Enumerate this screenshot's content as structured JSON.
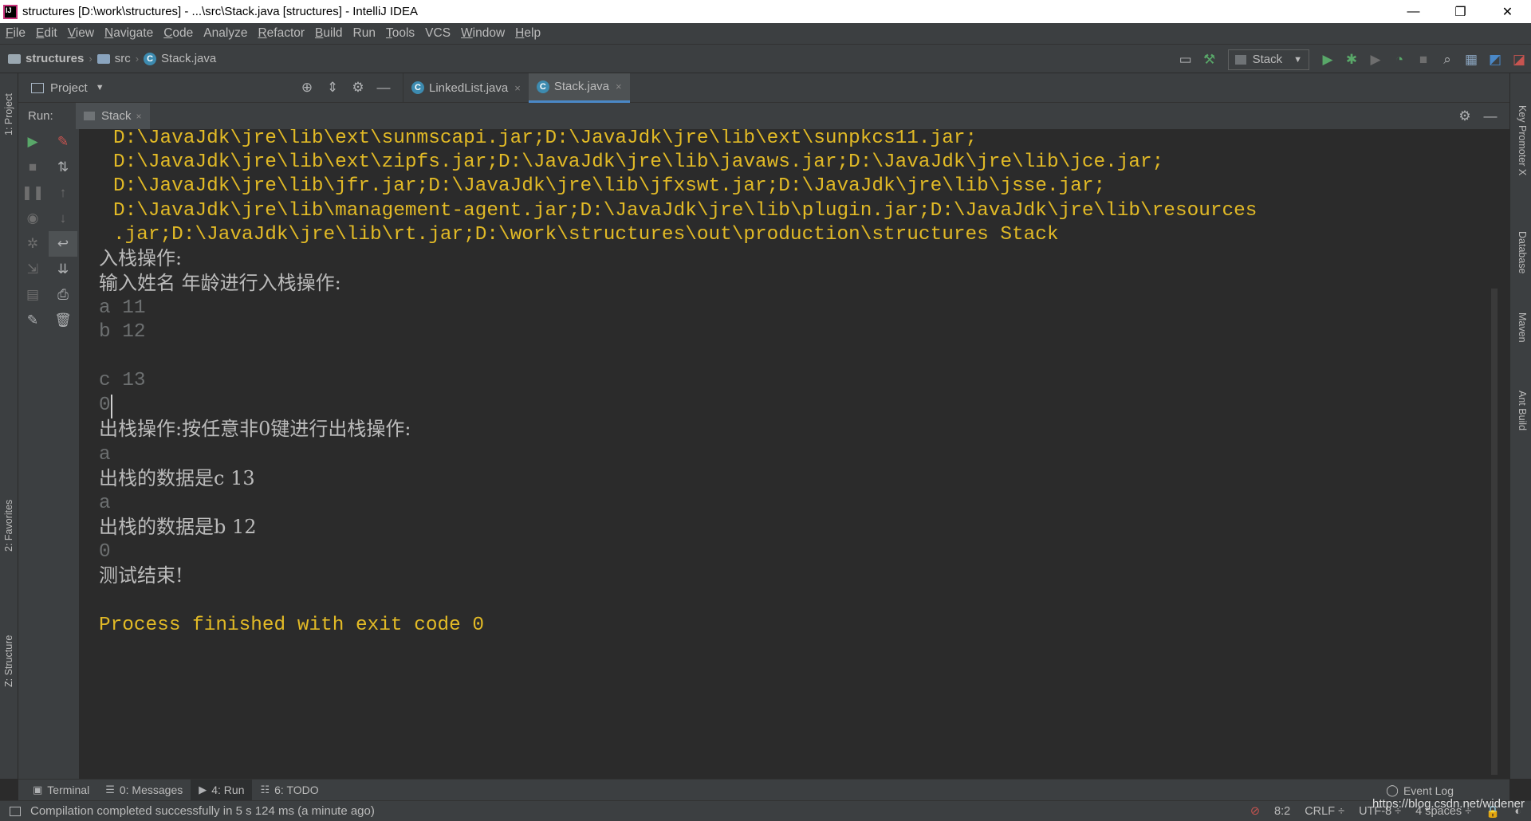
{
  "window": {
    "title": "structures [D:\\work\\structures] - ...\\src\\Stack.java [structures] - IntelliJ IDEA",
    "minimize": "—",
    "restore": "❐",
    "close": "✕"
  },
  "menu": {
    "items": [
      {
        "u": "F",
        "rest": "ile"
      },
      {
        "u": "E",
        "rest": "dit"
      },
      {
        "u": "V",
        "rest": "iew"
      },
      {
        "u": "N",
        "rest": "avigate"
      },
      {
        "u": "C",
        "rest": "ode"
      },
      {
        "u": "",
        "rest": "Analyze"
      },
      {
        "u": "R",
        "rest": "efactor"
      },
      {
        "u": "B",
        "rest": "uild"
      },
      {
        "u": "",
        "rest": "Run"
      },
      {
        "u": "T",
        "rest": "ools"
      },
      {
        "u": "",
        "rest": "VCS"
      },
      {
        "u": "W",
        "rest": "indow"
      },
      {
        "u": "H",
        "rest": "elp"
      }
    ]
  },
  "breadcrumb": {
    "project": "structures",
    "folder": "src",
    "file": "Stack.java"
  },
  "toolbar": {
    "run_config": "Stack"
  },
  "project_panel": {
    "label": "Project"
  },
  "editor_tabs": [
    {
      "label": "LinkedList.java",
      "active": false
    },
    {
      "label": "Stack.java",
      "active": true
    }
  ],
  "run_panel": {
    "label": "Run:",
    "tab": "Stack"
  },
  "left_stripe": {
    "project": "1: Project",
    "favorites": "2: Favorites",
    "structure": "Z: Structure"
  },
  "right_stripe": {
    "key_promoter": "Key Promoter X",
    "database": "Database",
    "maven": "Maven",
    "ant": "Ant Build"
  },
  "console": {
    "classpath_lines": [
      "D:\\JavaJdk\\jre\\lib\\ext\\sunmscapi.jar;D:\\JavaJdk\\jre\\lib\\ext\\sunpkcs11.jar;",
      "D:\\JavaJdk\\jre\\lib\\ext\\zipfs.jar;D:\\JavaJdk\\jre\\lib\\javaws.jar;D:\\JavaJdk\\jre\\lib\\jce.jar;",
      "D:\\JavaJdk\\jre\\lib\\jfr.jar;D:\\JavaJdk\\jre\\lib\\jfxswt.jar;D:\\JavaJdk\\jre\\lib\\jsse.jar;",
      "D:\\JavaJdk\\jre\\lib\\management-agent.jar;D:\\JavaJdk\\jre\\lib\\plugin.jar;D:\\JavaJdk\\jre\\lib\\resources",
      ".jar;D:\\JavaJdk\\jre\\lib\\rt.jar;D:\\work\\structures\\out\\production\\structures Stack"
    ],
    "push_title": "入栈操作:",
    "push_prompt": "输入姓名 年龄进行入栈操作:",
    "input_a": "a 11",
    "input_b": "b 12",
    "input_c": "c 13",
    "input_zero": "0",
    "pop_prompt": "出栈操作:按任意非0键进行出栈操作:",
    "input_pop1": "a",
    "pop_result1": "出栈的数据是c 13",
    "input_pop2": "a",
    "pop_result2": "出栈的数据是b 12",
    "input_end": "0",
    "test_end": "测试结束!",
    "exit": "Process finished with exit code 0"
  },
  "bottom_tabs": [
    {
      "label": "Terminal",
      "active": false
    },
    {
      "label": "0: Messages",
      "active": false
    },
    {
      "label": "4: Run",
      "active": true
    },
    {
      "label": "6: TODO",
      "active": false
    }
  ],
  "event_log": "Event Log",
  "status": {
    "message": "Compilation completed successfully in 5 s 124 ms (a minute ago)",
    "position": "8:2",
    "line_sep": "CRLF ÷",
    "encoding": "UTF-8 ÷",
    "indent": "4 spaces ÷"
  },
  "watermark": "https://blog.csdn.net/widener"
}
